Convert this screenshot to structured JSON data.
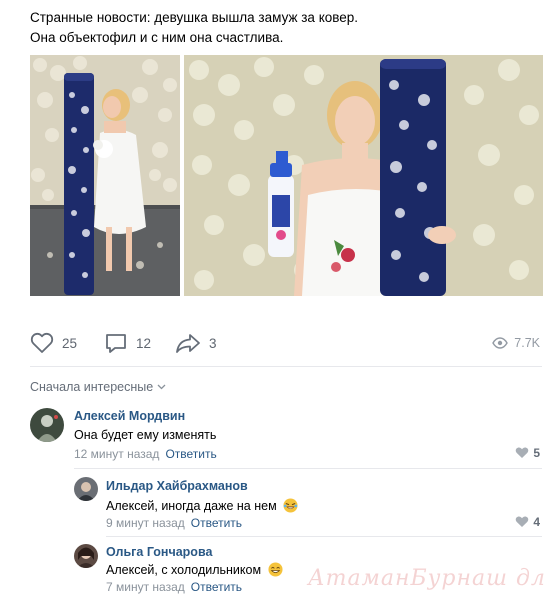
{
  "post": {
    "text_line1": "Странные новости: девушка вышла замуж за ковер.",
    "text_line2": "Она объектофил и с ним она счастлива."
  },
  "photos": [
    {
      "name": "photo-bride-kissing-carpet"
    },
    {
      "name": "photo-bride-with-carpet-and-cleaner"
    }
  ],
  "actions": {
    "likes": "25",
    "comments": "12",
    "shares": "3",
    "views": "7.7K"
  },
  "comments_sort": {
    "label": "Сначала интересные",
    "icon": "chevron-down-icon"
  },
  "comments": [
    {
      "author": "Алексей Мордвин",
      "text": "Она будет ему изменять",
      "time": "12 минут назад",
      "reply_label": "Ответить",
      "likes": "5"
    },
    {
      "author": "Ильдар Хайбрахманов",
      "text": "Алексей, иногда даже на нем",
      "emoji": "rofl-emoji",
      "time": "9 минут назад",
      "reply_label": "Ответить",
      "likes": "4"
    },
    {
      "author": "Ольга Гончарова",
      "text": "Алексей, с холодильником",
      "emoji": "grin-emoji",
      "time": "7 минут назад",
      "reply_label": "Ответить"
    }
  ],
  "watermark": "АтаманБурнаш для ЯП",
  "colors": {
    "link": "#2a5885",
    "muted": "#8a929b",
    "icon": "#656d78",
    "divider": "#e7e8ec"
  }
}
